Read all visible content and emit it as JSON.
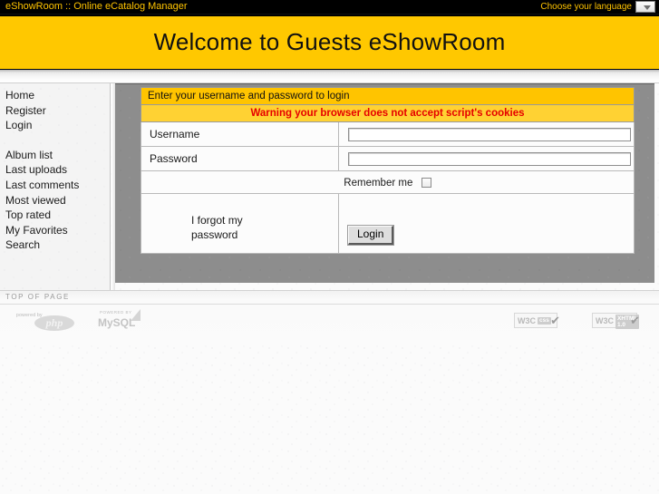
{
  "topbar": {
    "site_title": "eShowRoom :: Online eCatalog Manager",
    "language_label": "Choose your language",
    "language_selected": "",
    "language_icon": "chevron-down-icon",
    "bg_color": "#000000",
    "text_color": "#ffc400"
  },
  "banner": {
    "title": "Welcome to Guests eShowRoom",
    "bg_color": "#ffc800"
  },
  "sidebar": {
    "group_one": [
      {
        "label": "Home"
      },
      {
        "label": "Register"
      },
      {
        "label": "Login"
      }
    ],
    "group_two": [
      {
        "label": "Album list"
      },
      {
        "label": "Last uploads"
      },
      {
        "label": "Last comments"
      },
      {
        "label": "Most viewed"
      },
      {
        "label": "Top rated"
      },
      {
        "label": "My Favorites"
      },
      {
        "label": "Search"
      }
    ]
  },
  "login_form": {
    "header": "Enter your username and password to login",
    "header_bg": "#ffc400",
    "warning": "Warning your browser does not accept script's cookies",
    "warning_bg": "#ffd233",
    "warning_color": "#e60000",
    "username_label": "Username",
    "username_value": "",
    "username_placeholder": "",
    "password_label": "Password",
    "password_value": "",
    "password_placeholder": "",
    "remember_label": "Remember me",
    "remember_checked": false,
    "forgot_link": "I forgot my password",
    "submit_label": "Login"
  },
  "footer": {
    "top_of_page": "TOP OF PAGE",
    "php_powered": "powered by",
    "php_name": "php",
    "mysql_powered": "POWERED BY",
    "mysql_name": "MySQL",
    "w3c_css": {
      "mark": "W3C",
      "kind": "css",
      "check": "✔"
    },
    "w3c_xhtml": {
      "mark": "W3C",
      "kind": "XHTML 1.0",
      "check": "✔"
    }
  }
}
